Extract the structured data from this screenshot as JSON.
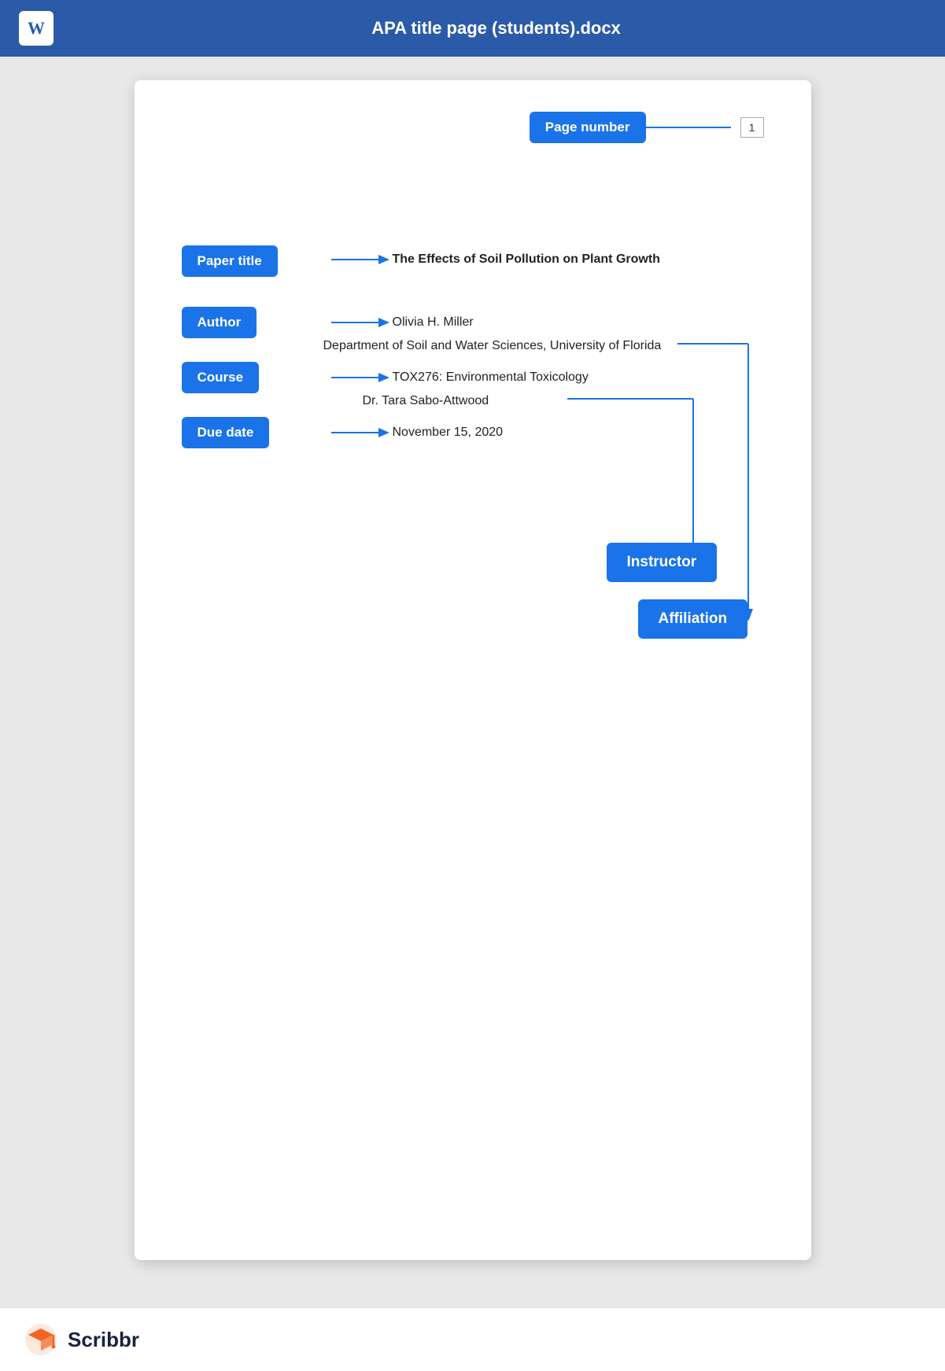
{
  "header": {
    "title": "APA title page (students).docx",
    "word_icon_label": "W"
  },
  "page_number": {
    "label": "Page number",
    "value": "1"
  },
  "annotations": {
    "paper_title": {
      "label": "Paper title",
      "value": "The Effects of Soil Pollution on Plant Growth"
    },
    "author": {
      "label": "Author",
      "value": "Olivia H. Miller"
    },
    "affiliation_line": {
      "value": "Department of Soil and Water Sciences, University of Florida"
    },
    "course": {
      "label": "Course",
      "value": "TOX276: Environmental Toxicology"
    },
    "instructor_line": {
      "value": "Dr. Tara Sabo-Attwood"
    },
    "due_date": {
      "label": "Due date",
      "value": "November 15, 2020"
    },
    "instructor_badge": {
      "label": "Instructor"
    },
    "affiliation_badge": {
      "label": "Affiliation"
    }
  },
  "footer": {
    "brand_name": "Scribbr"
  }
}
